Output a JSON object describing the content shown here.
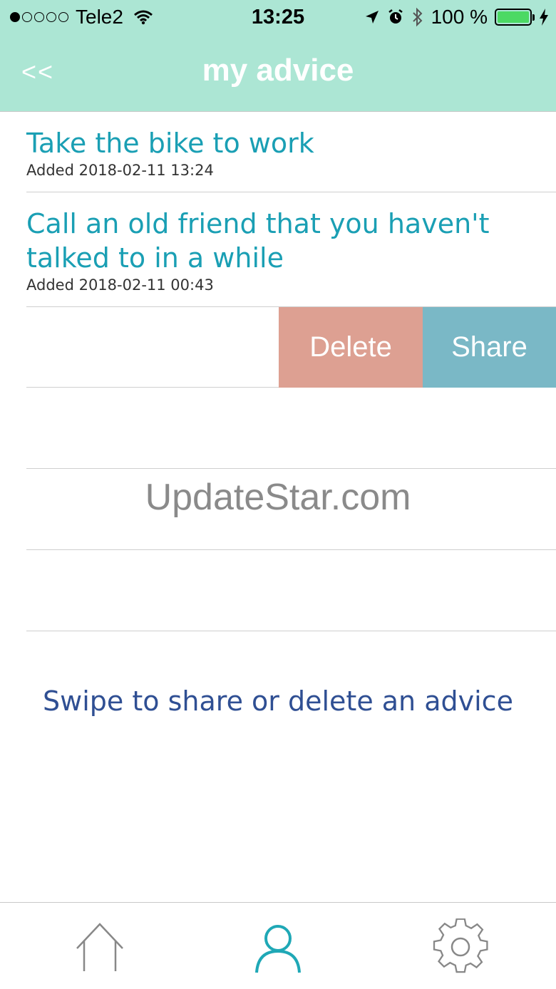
{
  "status_bar": {
    "carrier": "Tele2",
    "time": "13:25",
    "battery": "100 %"
  },
  "nav": {
    "back_label": "<<",
    "title": "my advice"
  },
  "advice_items": [
    {
      "title": "Take the bike to work",
      "added": "Added 2018-02-11 13:24"
    },
    {
      "title": "Call an old friend that you haven't talked to in a while",
      "added": "Added 2018-02-11 00:43"
    }
  ],
  "swipe_actions": {
    "delete_label": "Delete",
    "share_label": "Share"
  },
  "watermark": "UpdateStar.com",
  "hint": "Swipe to share or delete an advice",
  "tabbar": {
    "icons": [
      "home-icon",
      "profile-icon",
      "settings-icon"
    ],
    "active": "profile-icon"
  },
  "colors": {
    "header": "#ace6d4",
    "item_title": "#1a9fb4",
    "delete": "#dda092",
    "share": "#7ab8c6",
    "hint": "#2f4f93",
    "tab_active": "#1fa8b6",
    "tab_inactive": "#888888"
  }
}
